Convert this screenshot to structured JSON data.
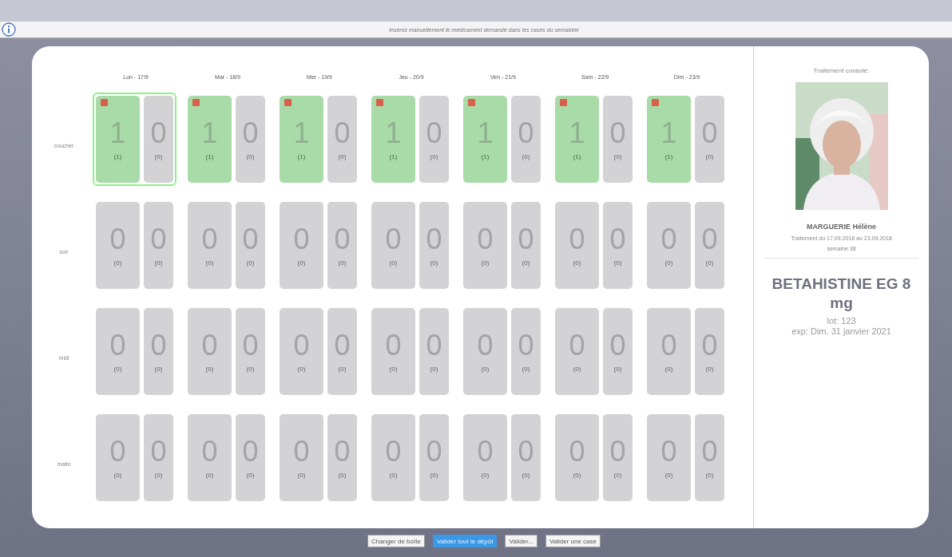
{
  "info_bar": {
    "message": "Insérez manuellement le médicament demandé dans les cases du semainier"
  },
  "days": [
    "Lun - 17/9",
    "Mar - 18/9",
    "Mer - 19/9",
    "Jeu - 20/9",
    "Ven - 21/9",
    "Sam - 22/9",
    "Dim - 23/9"
  ],
  "rows": [
    {
      "label": "coucher",
      "slots": [
        {
          "selected": true,
          "cells": [
            {
              "value": "1",
              "sub": "(1)",
              "filled": true
            },
            {
              "value": "0",
              "sub": "(0)",
              "filled": false
            }
          ]
        },
        {
          "selected": false,
          "cells": [
            {
              "value": "1",
              "sub": "(1)",
              "filled": true
            },
            {
              "value": "0",
              "sub": "(0)",
              "filled": false
            }
          ]
        },
        {
          "selected": false,
          "cells": [
            {
              "value": "1",
              "sub": "(1)",
              "filled": true
            },
            {
              "value": "0",
              "sub": "(0)",
              "filled": false
            }
          ]
        },
        {
          "selected": false,
          "cells": [
            {
              "value": "1",
              "sub": "(1)",
              "filled": true
            },
            {
              "value": "0",
              "sub": "(0)",
              "filled": false
            }
          ]
        },
        {
          "selected": false,
          "cells": [
            {
              "value": "1",
              "sub": "(1)",
              "filled": true
            },
            {
              "value": "0",
              "sub": "(0)",
              "filled": false
            }
          ]
        },
        {
          "selected": false,
          "cells": [
            {
              "value": "1",
              "sub": "(1)",
              "filled": true
            },
            {
              "value": "0",
              "sub": "(0)",
              "filled": false
            }
          ]
        },
        {
          "selected": false,
          "cells": [
            {
              "value": "1",
              "sub": "(1)",
              "filled": true
            },
            {
              "value": "0",
              "sub": "(0)",
              "filled": false
            }
          ]
        }
      ]
    },
    {
      "label": "soir",
      "slots": [
        {
          "selected": false,
          "cells": [
            {
              "value": "0",
              "sub": "(0)",
              "filled": false
            },
            {
              "value": "0",
              "sub": "(0)",
              "filled": false
            }
          ]
        },
        {
          "selected": false,
          "cells": [
            {
              "value": "0",
              "sub": "(0)",
              "filled": false
            },
            {
              "value": "0",
              "sub": "(0)",
              "filled": false
            }
          ]
        },
        {
          "selected": false,
          "cells": [
            {
              "value": "0",
              "sub": "(0)",
              "filled": false
            },
            {
              "value": "0",
              "sub": "(0)",
              "filled": false
            }
          ]
        },
        {
          "selected": false,
          "cells": [
            {
              "value": "0",
              "sub": "(0)",
              "filled": false
            },
            {
              "value": "0",
              "sub": "(0)",
              "filled": false
            }
          ]
        },
        {
          "selected": false,
          "cells": [
            {
              "value": "0",
              "sub": "(0)",
              "filled": false
            },
            {
              "value": "0",
              "sub": "(0)",
              "filled": false
            }
          ]
        },
        {
          "selected": false,
          "cells": [
            {
              "value": "0",
              "sub": "(0)",
              "filled": false
            },
            {
              "value": "0",
              "sub": "(0)",
              "filled": false
            }
          ]
        },
        {
          "selected": false,
          "cells": [
            {
              "value": "0",
              "sub": "(0)",
              "filled": false
            },
            {
              "value": "0",
              "sub": "(0)",
              "filled": false
            }
          ]
        }
      ]
    },
    {
      "label": "midi",
      "slots": [
        {
          "selected": false,
          "cells": [
            {
              "value": "0",
              "sub": "(0)",
              "filled": false
            },
            {
              "value": "0",
              "sub": "(0)",
              "filled": false
            }
          ]
        },
        {
          "selected": false,
          "cells": [
            {
              "value": "0",
              "sub": "(0)",
              "filled": false
            },
            {
              "value": "0",
              "sub": "(0)",
              "filled": false
            }
          ]
        },
        {
          "selected": false,
          "cells": [
            {
              "value": "0",
              "sub": "(0)",
              "filled": false
            },
            {
              "value": "0",
              "sub": "(0)",
              "filled": false
            }
          ]
        },
        {
          "selected": false,
          "cells": [
            {
              "value": "0",
              "sub": "(0)",
              "filled": false
            },
            {
              "value": "0",
              "sub": "(0)",
              "filled": false
            }
          ]
        },
        {
          "selected": false,
          "cells": [
            {
              "value": "0",
              "sub": "(0)",
              "filled": false
            },
            {
              "value": "0",
              "sub": "(0)",
              "filled": false
            }
          ]
        },
        {
          "selected": false,
          "cells": [
            {
              "value": "0",
              "sub": "(0)",
              "filled": false
            },
            {
              "value": "0",
              "sub": "(0)",
              "filled": false
            }
          ]
        },
        {
          "selected": false,
          "cells": [
            {
              "value": "0",
              "sub": "(0)",
              "filled": false
            },
            {
              "value": "0",
              "sub": "(0)",
              "filled": false
            }
          ]
        }
      ]
    },
    {
      "label": "matin",
      "slots": [
        {
          "selected": false,
          "cells": [
            {
              "value": "0",
              "sub": "(0)",
              "filled": false
            },
            {
              "value": "0",
              "sub": "(0)",
              "filled": false
            }
          ]
        },
        {
          "selected": false,
          "cells": [
            {
              "value": "0",
              "sub": "(0)",
              "filled": false
            },
            {
              "value": "0",
              "sub": "(0)",
              "filled": false
            }
          ]
        },
        {
          "selected": false,
          "cells": [
            {
              "value": "0",
              "sub": "(0)",
              "filled": false
            },
            {
              "value": "0",
              "sub": "(0)",
              "filled": false
            }
          ]
        },
        {
          "selected": false,
          "cells": [
            {
              "value": "0",
              "sub": "(0)",
              "filled": false
            },
            {
              "value": "0",
              "sub": "(0)",
              "filled": false
            }
          ]
        },
        {
          "selected": false,
          "cells": [
            {
              "value": "0",
              "sub": "(0)",
              "filled": false
            },
            {
              "value": "0",
              "sub": "(0)",
              "filled": false
            }
          ]
        },
        {
          "selected": false,
          "cells": [
            {
              "value": "0",
              "sub": "(0)",
              "filled": false
            },
            {
              "value": "0",
              "sub": "(0)",
              "filled": false
            }
          ]
        },
        {
          "selected": false,
          "cells": [
            {
              "value": "0",
              "sub": "(0)",
              "filled": false
            },
            {
              "value": "0",
              "sub": "(0)",
              "filled": false
            }
          ]
        }
      ]
    }
  ],
  "patient": {
    "heading": "Traitement consolé:",
    "name": "MARGUERIE Hélène",
    "period": "Traitement du 17.09.2018 au 23.09.2018",
    "week": "semaine 38"
  },
  "medication": {
    "name": "BETAHISTINE EG 8 mg",
    "lot": "lot: 123",
    "expiry": "exp: Dim. 31 janvier 2021"
  },
  "buttons": [
    {
      "label": "Changer de boîte",
      "kind": "default"
    },
    {
      "label": "Valider tout le dépôt",
      "kind": "primary"
    },
    {
      "label": "Valider...",
      "kind": "default"
    },
    {
      "label": "Valider une case",
      "kind": "default"
    }
  ]
}
